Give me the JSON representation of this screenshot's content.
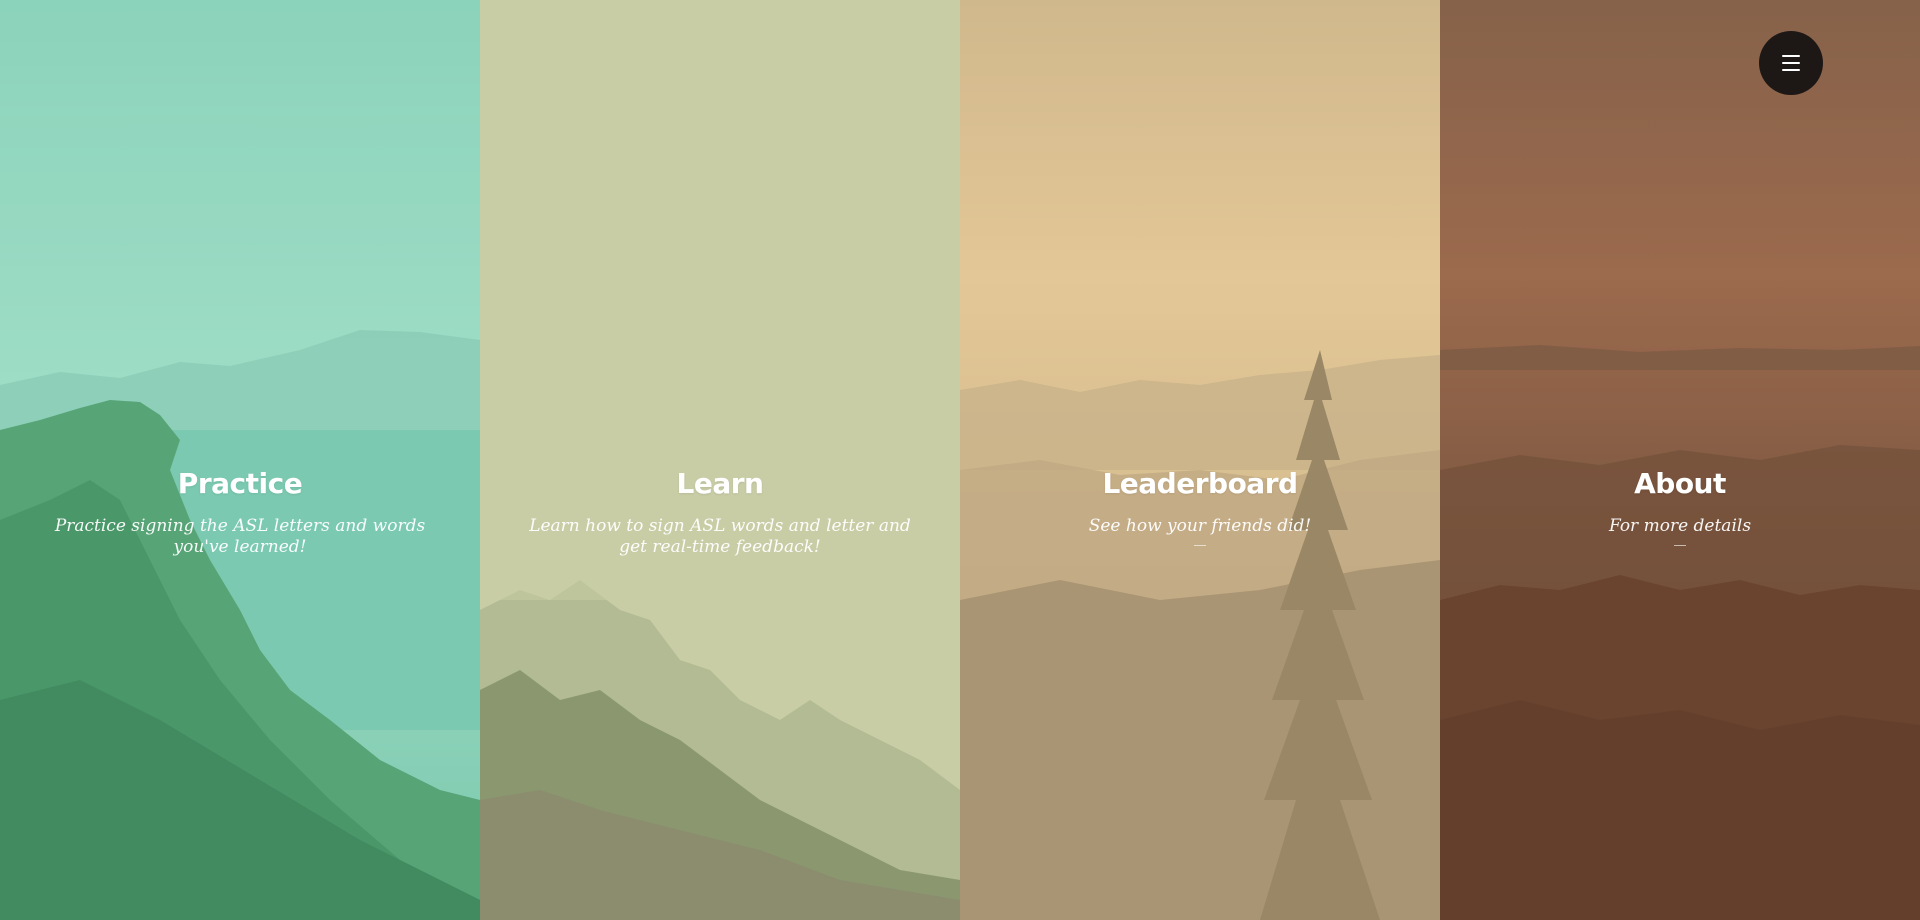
{
  "panels": [
    {
      "title": "Practice",
      "description": "Practice signing the ASL letters and words you've learned!",
      "overlay_color": "#7fd1b6"
    },
    {
      "title": "Learn",
      "description": "Learn how to sign ASL words and letter and get real-time feedback!",
      "overlay_color": "#c9cda6"
    },
    {
      "title": "Leaderboard",
      "description": "See how your friends did!",
      "overlay_color": "#d8b98a"
    },
    {
      "title": "About",
      "description": "For more details",
      "overlay_color": "#8a5a3e"
    }
  ],
  "menu": {
    "icon": "hamburger-menu-icon"
  }
}
